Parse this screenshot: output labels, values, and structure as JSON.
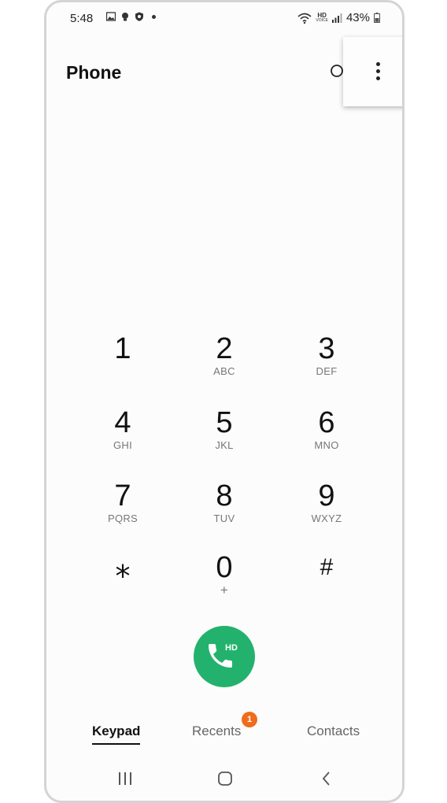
{
  "status_bar": {
    "time": "5:48",
    "left_icons": [
      "gallery-icon",
      "bulb-icon",
      "shield-icon"
    ],
    "right_icons": [
      "wifi-icon",
      "hd-voice-icon",
      "signal-icon",
      "battery-icon"
    ],
    "hd_voice": "HD",
    "hd_voice_sub": "VOICE",
    "battery": "43%"
  },
  "header": {
    "title": "Phone"
  },
  "keypad": {
    "keys": [
      {
        "digit": "1",
        "letters": ""
      },
      {
        "digit": "2",
        "letters": "ABC"
      },
      {
        "digit": "3",
        "letters": "DEF"
      },
      {
        "digit": "4",
        "letters": "GHI"
      },
      {
        "digit": "5",
        "letters": "JKL"
      },
      {
        "digit": "6",
        "letters": "MNO"
      },
      {
        "digit": "7",
        "letters": "PQRS"
      },
      {
        "digit": "8",
        "letters": "TUV"
      },
      {
        "digit": "9",
        "letters": "WXYZ"
      },
      {
        "digit": "⁎",
        "letters": ""
      },
      {
        "digit": "0",
        "letters": "+"
      },
      {
        "digit": "#",
        "letters": ""
      }
    ]
  },
  "call_button": {
    "label": "HD"
  },
  "tabs": [
    {
      "label": "Keypad",
      "active": true
    },
    {
      "label": "Recents",
      "active": false,
      "badge": "1"
    },
    {
      "label": "Contacts",
      "active": false
    }
  ],
  "colors": {
    "call_green": "#23b26d",
    "badge_orange": "#ef6c1c"
  }
}
